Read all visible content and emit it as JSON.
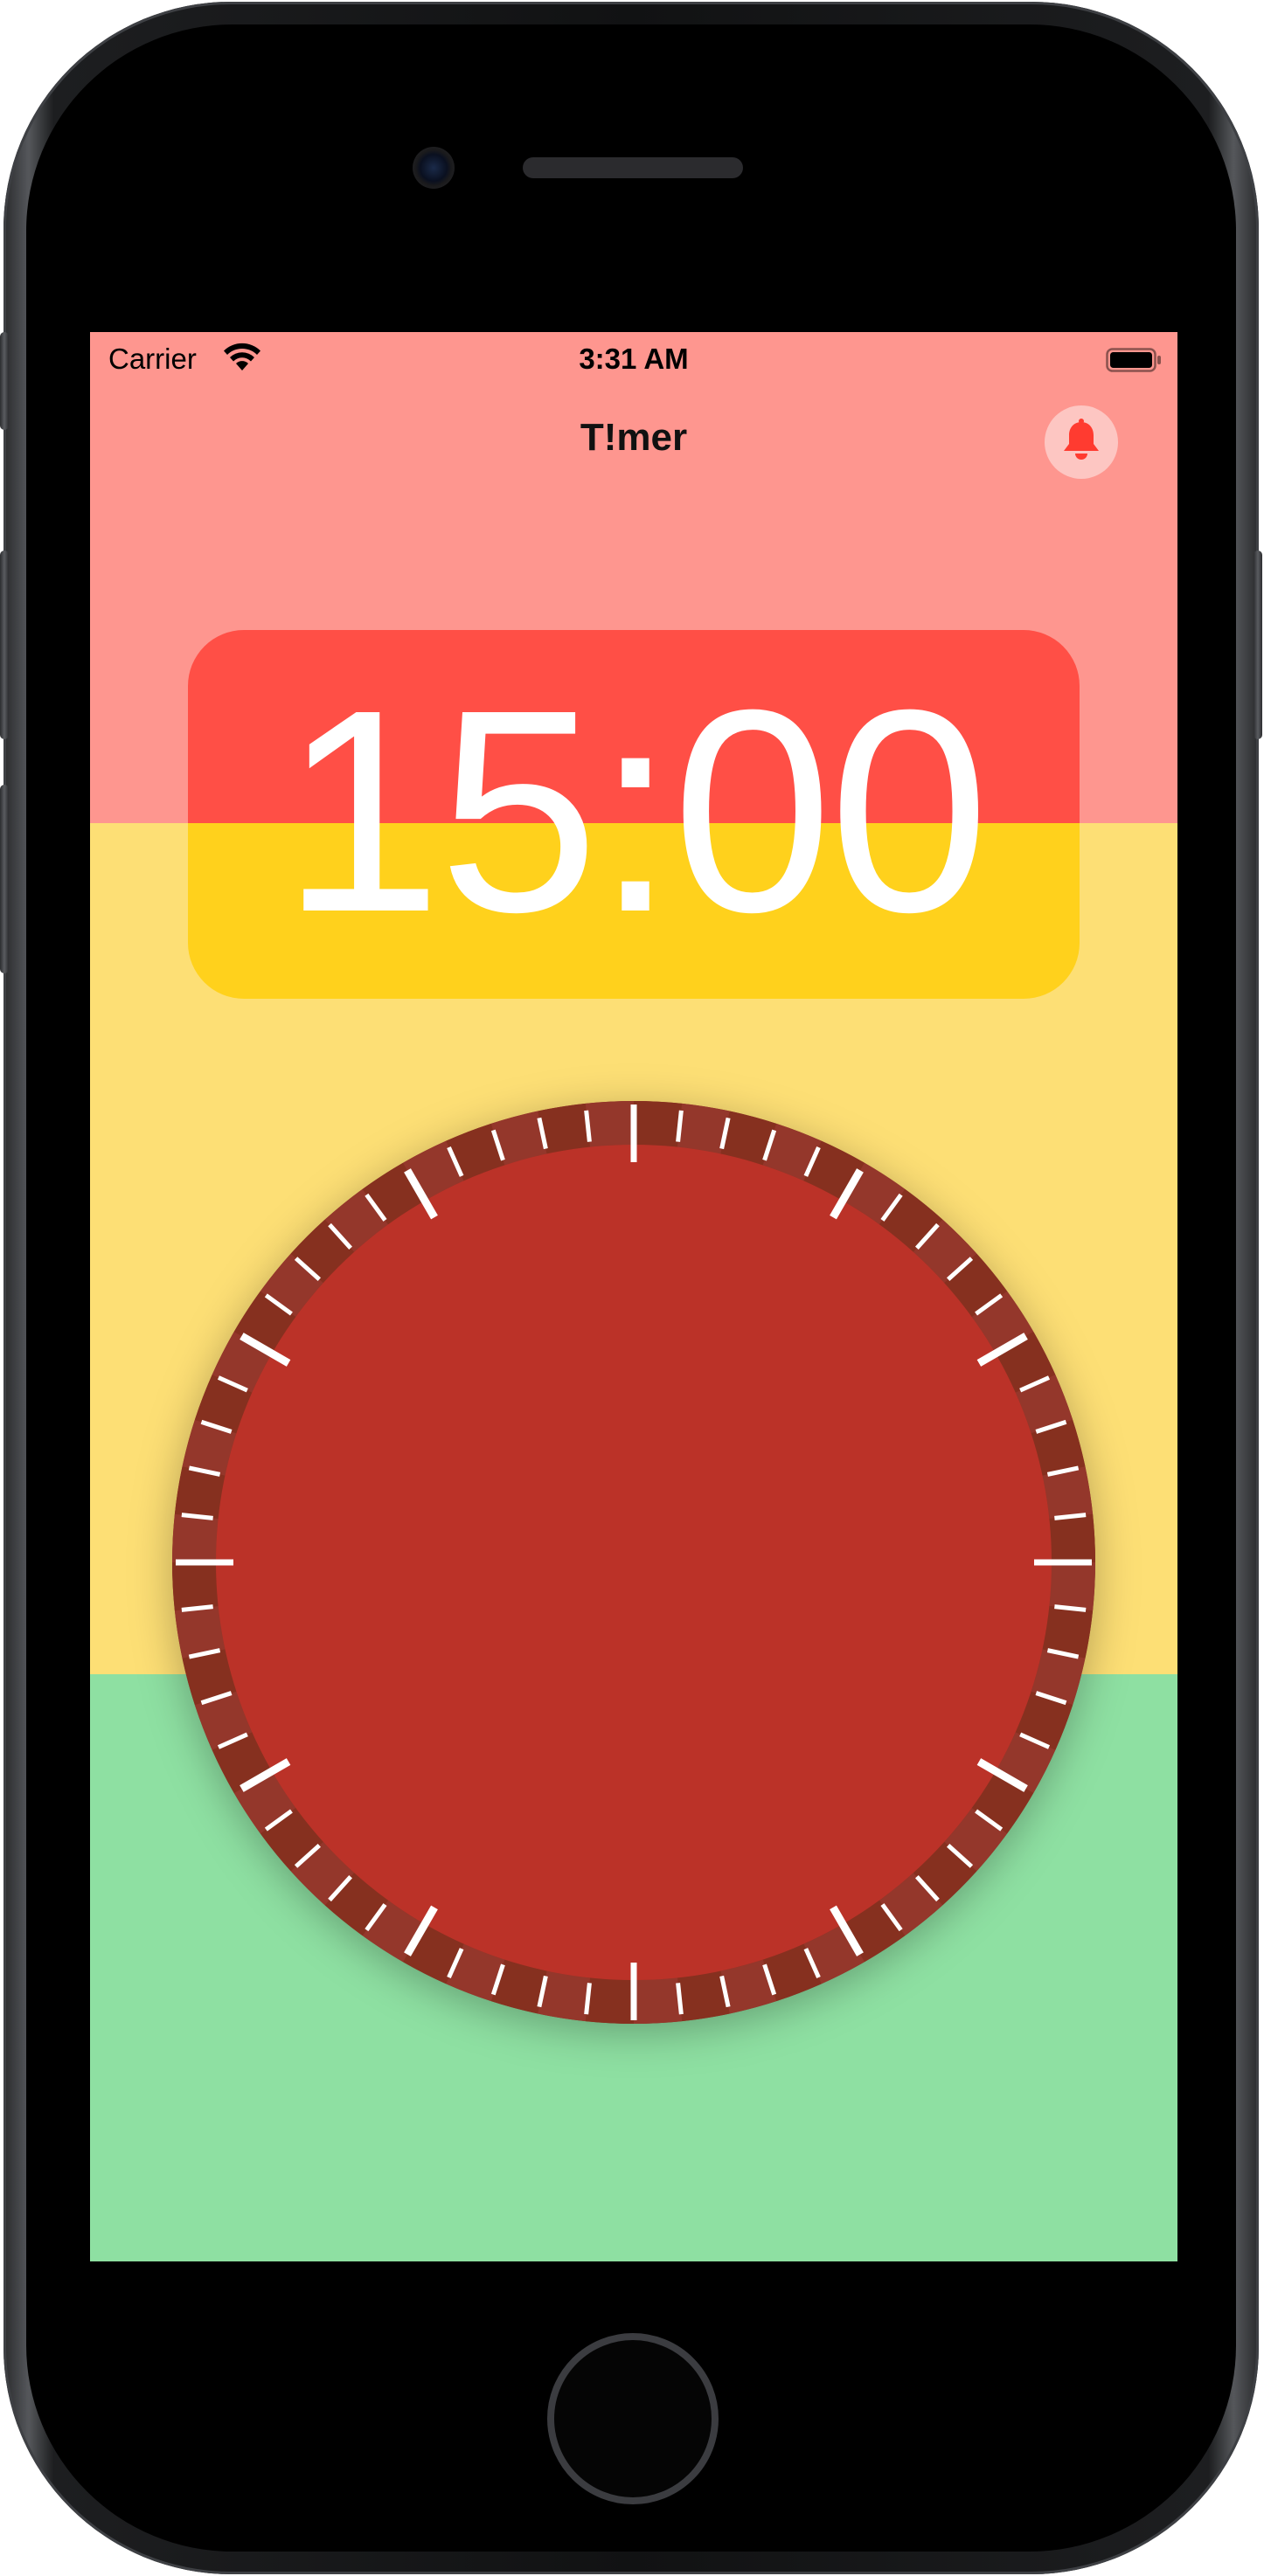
{
  "status_bar": {
    "carrier": "Carrier",
    "time": "3:31 AM"
  },
  "nav": {
    "title": "T!mer",
    "alarm_button_icon": "bell-icon"
  },
  "timer": {
    "display": "15:00"
  },
  "dial": {
    "tick_count": 60,
    "major_every": 5,
    "face_color": "#bb3228",
    "ring_color": "#8d3125",
    "tick_color": "#ffffff"
  },
  "colors": {
    "band_red": "#fe968f",
    "band_yellow": "#fddf75",
    "band_green": "#8ee0a2",
    "card_red": "#ff4f46",
    "card_yellow": "#ffd11c",
    "bell_red": "#ff3b30"
  }
}
